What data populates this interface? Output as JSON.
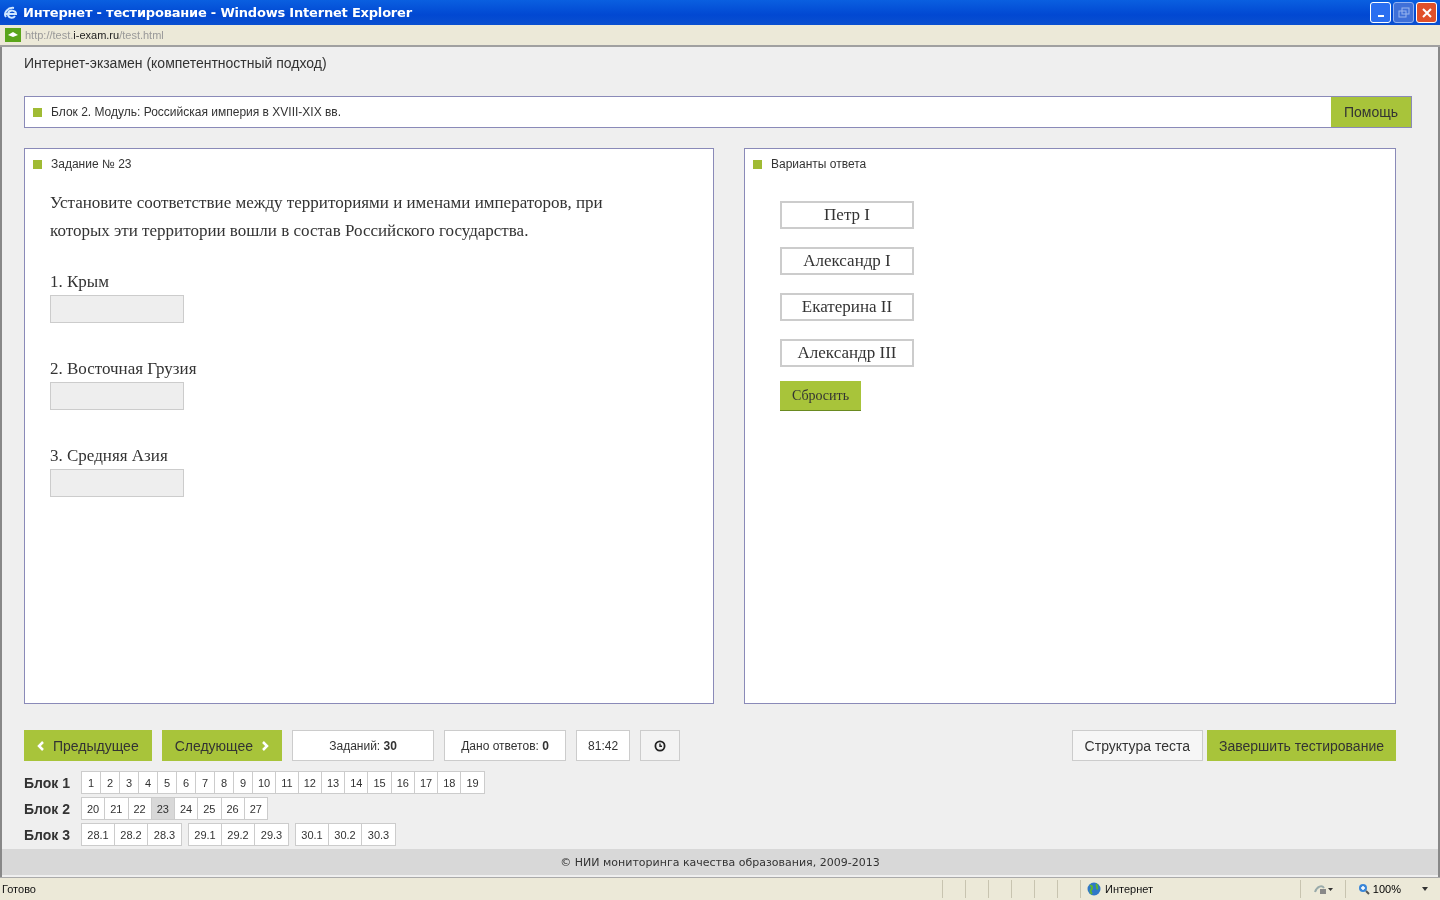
{
  "window": {
    "title": "Интернет - тестирование - Windows Internet Explorer"
  },
  "address": {
    "prefix": "http://test.",
    "domain": "i-exam.ru",
    "suffix": "/test.html"
  },
  "page_title": "Интернет-экзамен (компетентностный подход)",
  "module": {
    "label": "Блок 2. Модуль: Российская империя в XVIII-XIX вв.",
    "help_button": "Помощь"
  },
  "task": {
    "heading": "Задание № 23",
    "question": "Установите соответствие между территориями и именами императоров, при которых эти территории вошли в состав Российского государства.",
    "items": [
      {
        "label": "1. Крым"
      },
      {
        "label": "2. Восточная Грузия"
      },
      {
        "label": "3. Средняя Азия"
      }
    ]
  },
  "answers": {
    "heading": "Варианты ответа",
    "options": [
      "Петр I",
      "Александр I",
      "Екатерина II",
      "Александр III"
    ],
    "reset_button": "Сбросить"
  },
  "nav": {
    "prev": "Предыдущее",
    "next": "Следующее",
    "tasks_count": "Заданий: **30**",
    "answered": "Дано ответов: **0**",
    "timer": "81:42",
    "structure": "Структура теста",
    "finish": "Завершить тестирование"
  },
  "blocks": [
    {
      "label": "Блок 1",
      "groups": [
        [
          {
            "n": "1",
            "selected": false
          },
          {
            "n": "2",
            "selected": false
          },
          {
            "n": "3",
            "selected": false
          },
          {
            "n": "4",
            "selected": false
          },
          {
            "n": "5",
            "selected": false
          },
          {
            "n": "6",
            "selected": false
          },
          {
            "n": "7",
            "selected": false
          },
          {
            "n": "8",
            "selected": false
          },
          {
            "n": "9",
            "selected": false
          },
          {
            "n": "10",
            "selected": false
          },
          {
            "n": "11",
            "selected": false
          },
          {
            "n": "12",
            "selected": false
          },
          {
            "n": "13",
            "selected": false
          },
          {
            "n": "14",
            "selected": false
          },
          {
            "n": "15",
            "selected": false
          },
          {
            "n": "16",
            "selected": false
          },
          {
            "n": "17",
            "selected": false
          },
          {
            "n": "18",
            "selected": false
          },
          {
            "n": "19",
            "selected": false
          }
        ]
      ]
    },
    {
      "label": "Блок 2",
      "groups": [
        [
          {
            "n": "20",
            "selected": false
          },
          {
            "n": "21",
            "selected": false
          },
          {
            "n": "22",
            "selected": false
          },
          {
            "n": "23",
            "selected": true
          },
          {
            "n": "24",
            "selected": false
          },
          {
            "n": "25",
            "selected": false
          },
          {
            "n": "26",
            "selected": false
          },
          {
            "n": "27",
            "selected": false
          }
        ]
      ]
    },
    {
      "label": "Блок 3",
      "groups": [
        [
          {
            "n": "28.1",
            "selected": false
          },
          {
            "n": "28.2",
            "selected": false
          },
          {
            "n": "28.3",
            "selected": false
          }
        ],
        [
          {
            "n": "29.1",
            "selected": false
          },
          {
            "n": "29.2",
            "selected": false
          },
          {
            "n": "29.3",
            "selected": false
          }
        ],
        [
          {
            "n": "30.1",
            "selected": false
          },
          {
            "n": "30.2",
            "selected": false
          },
          {
            "n": "30.3",
            "selected": false
          }
        ]
      ]
    }
  ],
  "footer": "© НИИ мониторинга качества образования, 2009-2013",
  "status_bar": {
    "text": "Готово",
    "zone": "Интернет",
    "zoom": "100%"
  }
}
